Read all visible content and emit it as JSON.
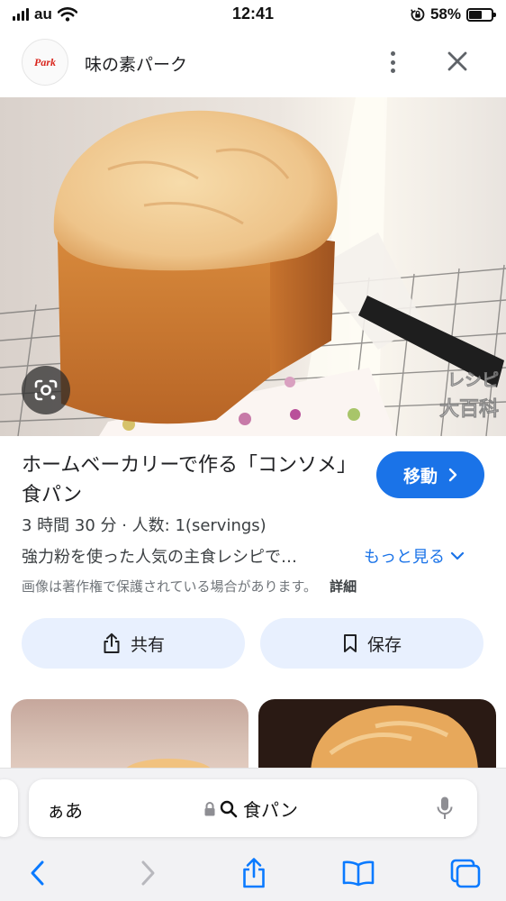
{
  "status_bar": {
    "carrier": "au",
    "time": "12:41",
    "battery": "58%",
    "battery_level": 0.58
  },
  "source": {
    "logo_text": "Park",
    "name": "味の素パーク"
  },
  "hero": {
    "watermark": "レシピ大百科"
  },
  "result": {
    "title": "ホームベーカリーで作る「コンソメ」食パン",
    "goto_label": "移動",
    "meta": "3 時間 30 分 · 人数: 1(servings)",
    "description": "強力粉を使った人気の主食レシピで…",
    "more_label": "もっと見る",
    "copyright": "画像は著作権で保護されている場合があります。",
    "details_label": "詳細"
  },
  "actions": {
    "share_label": "共有",
    "save_label": "保存"
  },
  "safari": {
    "aa_label": "ぁあ",
    "url": "食パン"
  },
  "colors": {
    "accent": "#1a73e8",
    "action_bg": "#e8f0fe",
    "safari_blue": "#0a7aff"
  }
}
